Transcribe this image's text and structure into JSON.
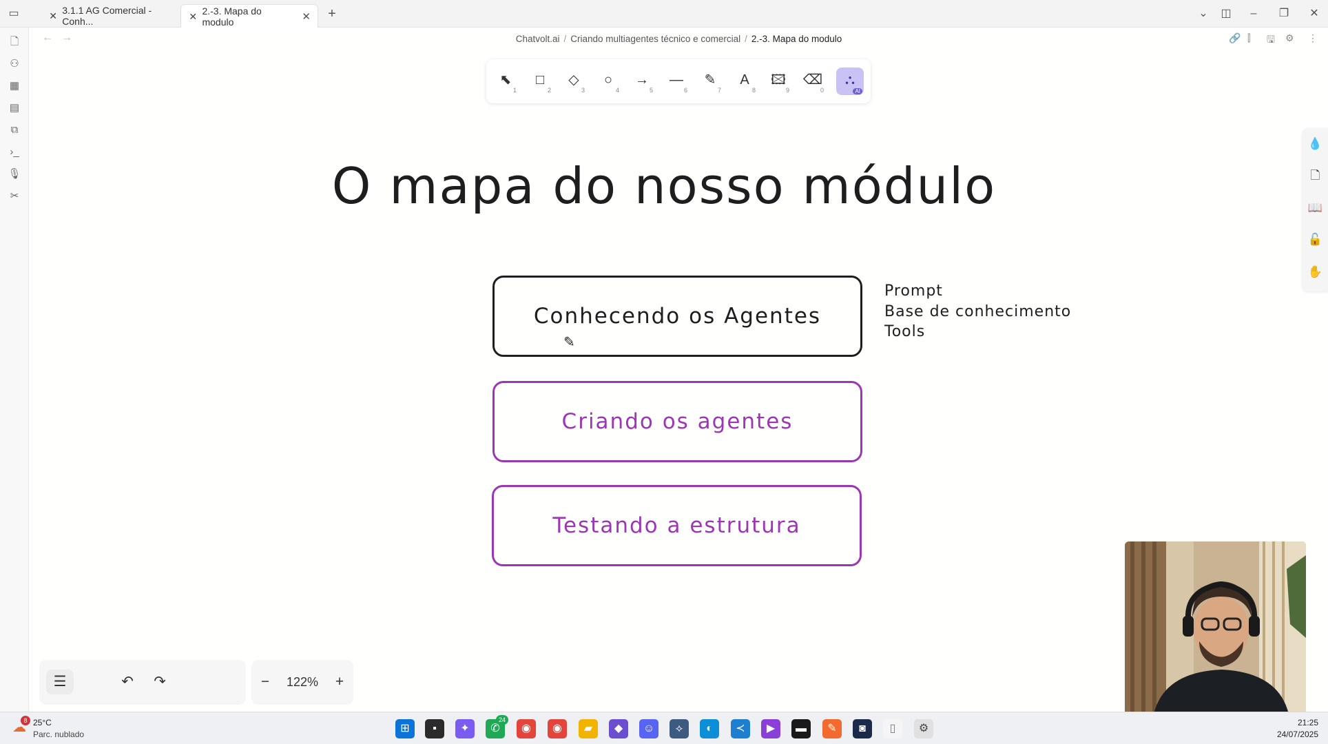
{
  "tabs": [
    {
      "label": "3.1.1 AG Comercial - Conh..."
    },
    {
      "label": "2.-3. Mapa do modulo"
    }
  ],
  "breadcrumb": [
    "Chatvolt.ai",
    "Criando multiagentes técnico e comercial",
    "2.-3. Mapa do modulo"
  ],
  "toolbar": {
    "tools": [
      {
        "icon": "selection-arrow-icon",
        "key": "1"
      },
      {
        "icon": "rectangle-icon",
        "key": "2"
      },
      {
        "icon": "diamond-icon",
        "key": "3"
      },
      {
        "icon": "ellipse-icon",
        "key": "4"
      },
      {
        "icon": "arrow-icon",
        "key": "5"
      },
      {
        "icon": "line-icon",
        "key": "6"
      },
      {
        "icon": "pencil-icon",
        "key": "7"
      },
      {
        "icon": "text-icon",
        "key": "8"
      },
      {
        "icon": "image-icon",
        "key": "9"
      },
      {
        "icon": "eraser-icon",
        "key": "0"
      },
      {
        "icon": "shapes-library-icon",
        "key": "AI",
        "selected": true
      }
    ]
  },
  "drawing": {
    "title": "O mapa do nosso módulo",
    "boxes": [
      {
        "label": "Conhecendo os Agentes",
        "color": "#1e1e1e"
      },
      {
        "label": "Criando os agentes",
        "color": "#9c36b5"
      },
      {
        "label": "Testando a estrutura",
        "color": "#9c36b5"
      }
    ],
    "side_list": [
      "Prompt",
      "Base de conhecimento",
      "Tools"
    ]
  },
  "zoom": {
    "value": "122%"
  },
  "taskbar": {
    "weather_temp": "25°C",
    "weather_desc": "Parc. nublado",
    "weather_badge": "8",
    "whatsapp_badge": "24",
    "time": "21:25",
    "date": "24/07/2025"
  }
}
